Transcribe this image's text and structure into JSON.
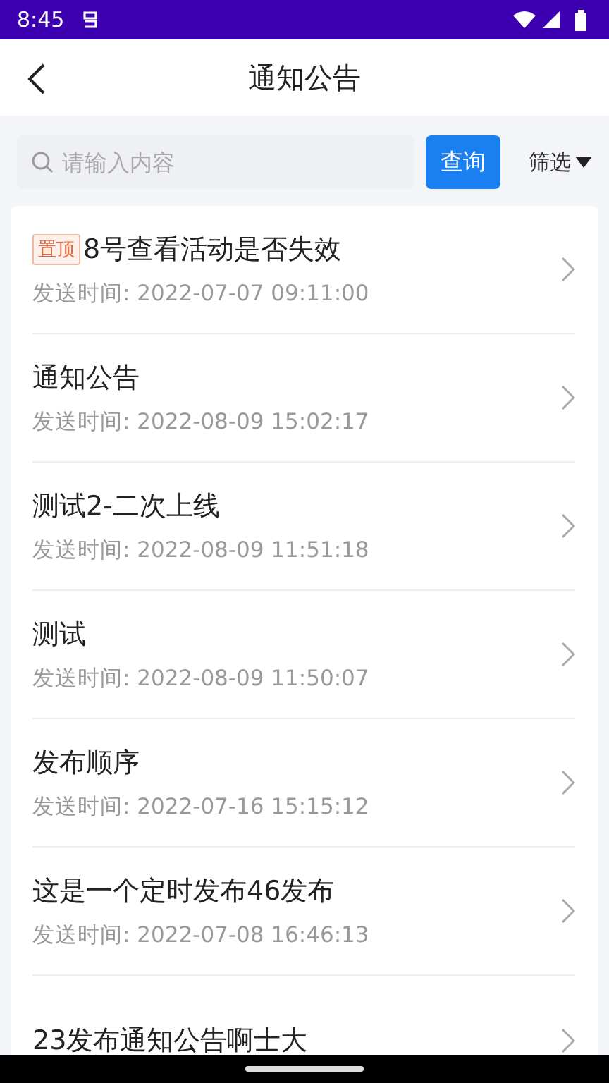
{
  "status_bar": {
    "time": "8:45"
  },
  "header": {
    "title": "通知公告"
  },
  "search": {
    "placeholder": "请输入内容",
    "button": "查询",
    "filter": "筛选"
  },
  "notices": [
    {
      "tag": "置顶",
      "title": "8号查看活动是否失效",
      "time": "发送时间: 2022-07-07 09:11:00"
    },
    {
      "title": "通知公告",
      "time": "发送时间: 2022-08-09 15:02:17"
    },
    {
      "title": "测试2-二次上线",
      "time": "发送时间: 2022-08-09 11:51:18"
    },
    {
      "title": "测试",
      "time": "发送时间: 2022-08-09 11:50:07"
    },
    {
      "title": "发布顺序",
      "time": "发送时间: 2022-07-16 15:15:12"
    },
    {
      "title": "这是一个定时发布46发布",
      "time": "发送时间: 2022-07-08 16:46:13"
    },
    {
      "title": "23发布通知公告啊士大"
    }
  ]
}
